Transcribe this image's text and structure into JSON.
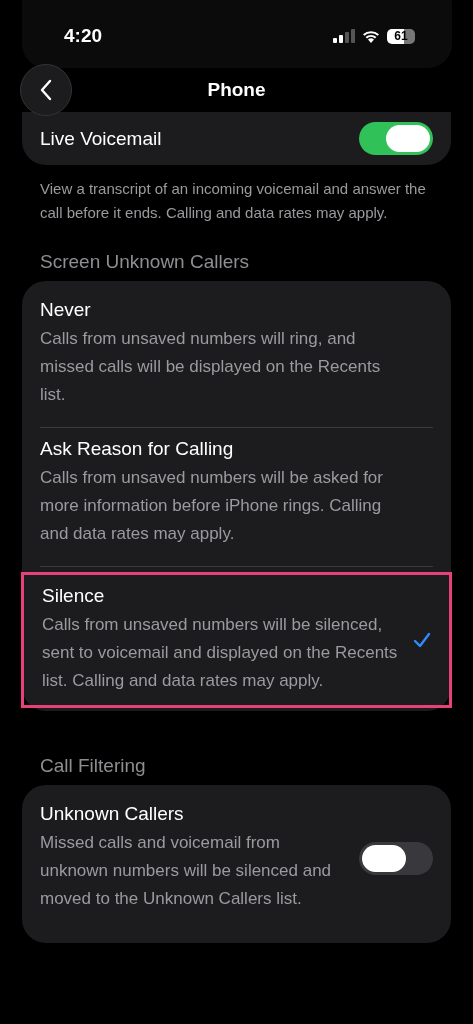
{
  "status_bar": {
    "time": "4:20",
    "battery": "61"
  },
  "nav": {
    "title": "Phone"
  },
  "live_voicemail": {
    "label": "Live Voicemail",
    "on": true,
    "footer": "View a transcript of an incoming voicemail and answer the call before it ends. Calling and data rates may apply."
  },
  "screen_unknown_callers": {
    "header": "Screen Unknown Callers",
    "options": [
      {
        "title": "Never",
        "description": "Calls from unsaved numbers will ring, and missed calls will be displayed on the Recents list.",
        "selected": false,
        "highlighted": false
      },
      {
        "title": "Ask Reason for Calling",
        "description": "Calls from unsaved numbers will be asked for more information before iPhone rings. Calling and data rates may apply.",
        "selected": false,
        "highlighted": false
      },
      {
        "title": "Silence",
        "description": "Calls from unsaved numbers will be silenced, sent to voicemail and displayed on the Recents list. Calling and data rates may apply.",
        "selected": true,
        "highlighted": true
      }
    ]
  },
  "call_filtering": {
    "header": "Call Filtering",
    "label": "Unknown Callers",
    "description": "Missed calls and voicemail from unknown numbers will be silenced and moved to the Unknown Callers list.",
    "on": false
  }
}
